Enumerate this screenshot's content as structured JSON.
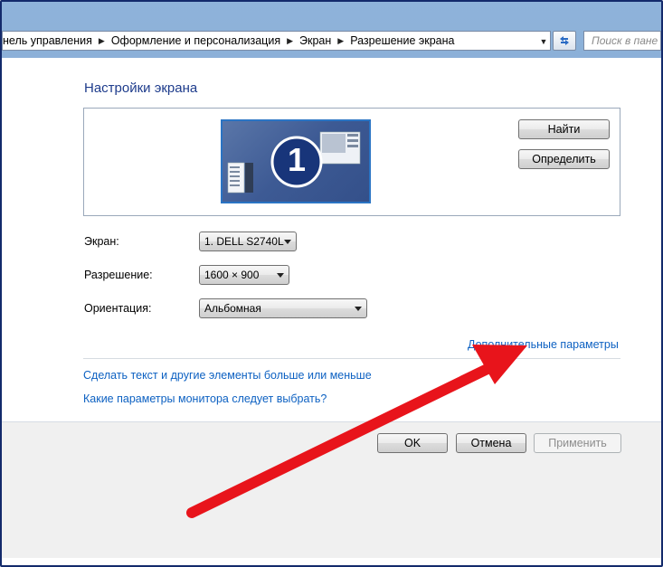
{
  "address_bar": {
    "crumbs": [
      "нель управления",
      "Оформление и персонализация",
      "Экран",
      "Разрешение экрана"
    ],
    "search_placeholder": "Поиск в пане"
  },
  "page": {
    "title": "Настройки экрана"
  },
  "preview": {
    "monitor_number": "1",
    "buttons": {
      "find": "Найти",
      "identify": "Определить"
    }
  },
  "settings": {
    "display": {
      "label": "Экран:",
      "value": "1. DELL S2740L"
    },
    "resolution": {
      "label": "Разрешение:",
      "value": "1600 × 900"
    },
    "orientation": {
      "label": "Ориентация:",
      "value": "Альбомная"
    }
  },
  "links": {
    "advanced": "Дополнительные параметры",
    "text_size": "Сделать текст и другие элементы больше или меньше",
    "which_params": "Какие параметры монитора следует выбрать?"
  },
  "footer": {
    "ok": "OK",
    "cancel": "Отмена",
    "apply": "Применить"
  },
  "colors": {
    "link": "#0d61c2",
    "title": "#1e3c8c",
    "annotation_arrow": "#e8141b"
  }
}
